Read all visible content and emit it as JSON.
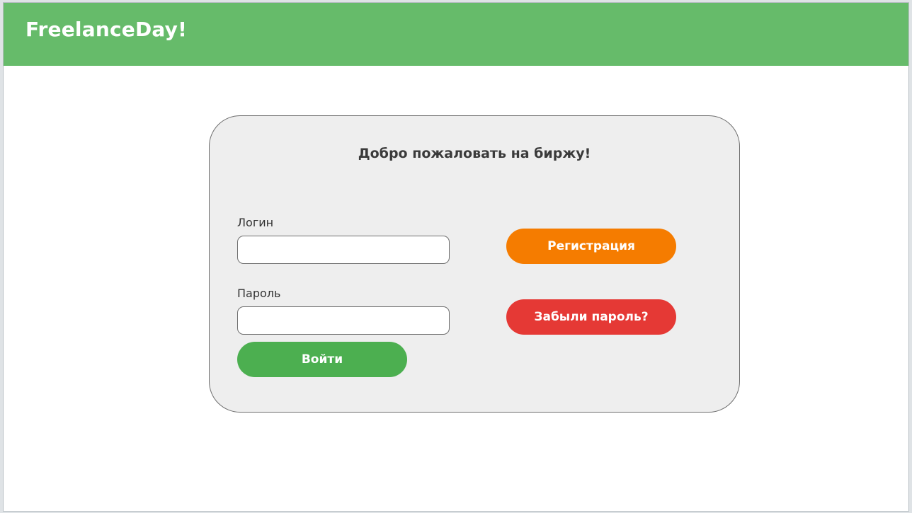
{
  "header": {
    "brand": "FreelanceDay!",
    "color": "#66bb6a"
  },
  "login_card": {
    "title": "Добро пожаловать на биржу!",
    "login_label": "Логин",
    "login_value": "",
    "password_label": "Пароль",
    "password_value": "",
    "login_button": "Войти",
    "register_button": "Регистрация",
    "forgot_button": "Забыли пароль?"
  },
  "colors": {
    "login_button": "#4caf50",
    "register_button": "#f57c00",
    "forgot_button": "#e53935",
    "card_background": "#eeeeee"
  }
}
